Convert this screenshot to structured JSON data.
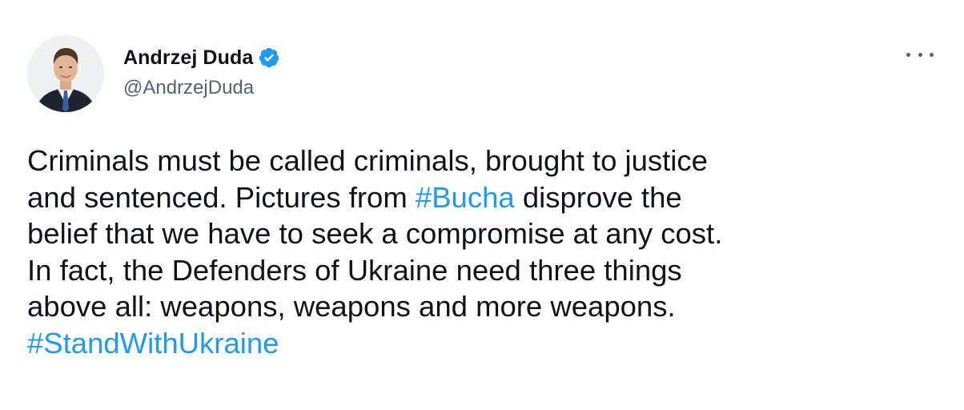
{
  "author": {
    "display_name": "Andrzej Duda",
    "handle": "@AndrzejDuda",
    "verified_icon": "verified-badge-icon",
    "avatar_icon": "profile-photo"
  },
  "menu": {
    "icon": "more-options-icon"
  },
  "tweet": {
    "line1": "Criminals must be called criminals, brought to justice",
    "line2_before": "and sentenced. Pictures from ",
    "hashtag_bucha": "#Bucha",
    "line2_after": " disprove the",
    "line3": "belief that we have to seek a compromise at any cost.",
    "line4": "In fact, the Defenders of Ukraine need three things",
    "line5": "above all: weapons, weapons and more weapons.",
    "hashtag_standwithukraine": "#StandWithUkraine"
  },
  "colors": {
    "hashtag": "#1d9bf0",
    "verified": "#1d9bf0",
    "text": "#0f1419",
    "secondary": "#536471"
  }
}
